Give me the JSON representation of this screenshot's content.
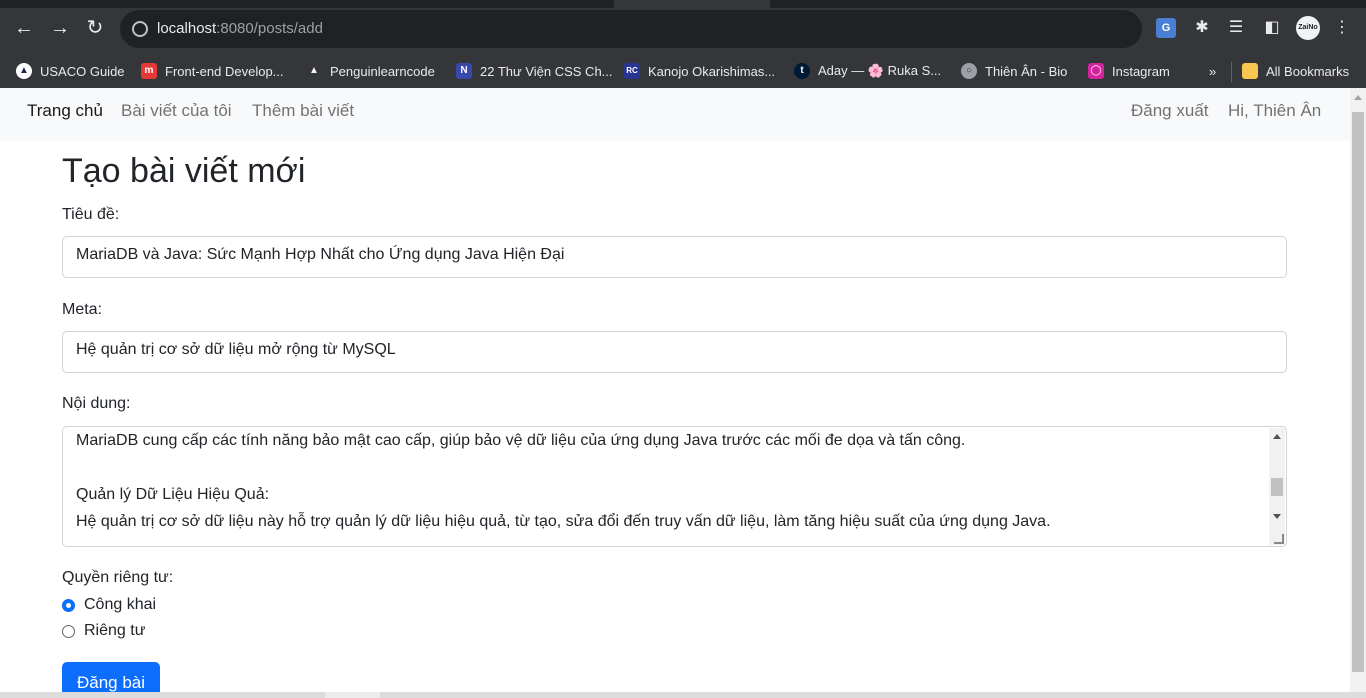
{
  "browser": {
    "url_host": "localhost",
    "url_rest": ":8080/posts/add",
    "avatar_text": "ZaiNo",
    "translate_icon": "G",
    "bookmarks": [
      {
        "label": "USACO Guide",
        "icon": "usaco-icon",
        "color": "#ffffff"
      },
      {
        "label": "Front-end Develop...",
        "icon": "m-logo-icon",
        "color": "#e53935"
      },
      {
        "label": "Penguinlearncode",
        "icon": "penguin-icon",
        "color": "#f5f5f5"
      },
      {
        "label": "22 Thư Viện CSS Ch...",
        "icon": "n-logo-icon",
        "color": "#3949ab"
      },
      {
        "label": "Kanojo Okarishimas...",
        "icon": "rc-logo-icon",
        "color": "#283593"
      },
      {
        "label": "Aday — 🌸 Ruka S...",
        "icon": "tumblr-icon",
        "color": "#001935"
      },
      {
        "label": "Thiên Ân - Bio",
        "icon": "globe-icon",
        "color": "#9aa0a6"
      },
      {
        "label": "Instagram",
        "icon": "instagram-icon",
        "color": "#d6249f"
      }
    ],
    "more_label": "»",
    "all_bookmarks": "All Bookmarks"
  },
  "navbar": {
    "home": "Trang chủ",
    "my_posts": "Bài viết của tôi",
    "add_post": "Thêm bài viết",
    "logout": "Đăng xuất",
    "greeting": "Hi, Thiên Ân"
  },
  "form": {
    "heading": "Tạo bài viết mới",
    "title_label": "Tiêu đề:",
    "title_value": "MariaDB và Java: Sức Mạnh Hợp Nhất cho Ứng dụng Java Hiện Đại",
    "meta_label": "Meta:",
    "meta_value": "Hệ quản trị cơ sở dữ liệu mở rộng từ MySQL",
    "content_label": "Nội dung:",
    "content_value": "MariaDB cung cấp các tính năng bảo mật cao cấp, giúp bảo vệ dữ liệu của ứng dụng Java trước các mối đe dọa và tấn công.\n\nQuản lý Dữ Liệu Hiệu Quả:\nHệ quản trị cơ sở dữ liệu này hỗ trợ quản lý dữ liệu hiệu quả, từ tạo, sửa đổi đến truy vấn dữ liệu, làm tăng hiệu suất của ứng dụng Java.",
    "privacy_label": "Quyền riêng tư:",
    "privacy_options": [
      {
        "label": "Công khai",
        "checked": true
      },
      {
        "label": "Riêng tư",
        "checked": false
      }
    ],
    "submit": "Đăng bài"
  },
  "colors": {
    "primary": "#0d6efd",
    "navbar_bg": "#f8f9fa",
    "chrome_bg": "#35363a"
  }
}
